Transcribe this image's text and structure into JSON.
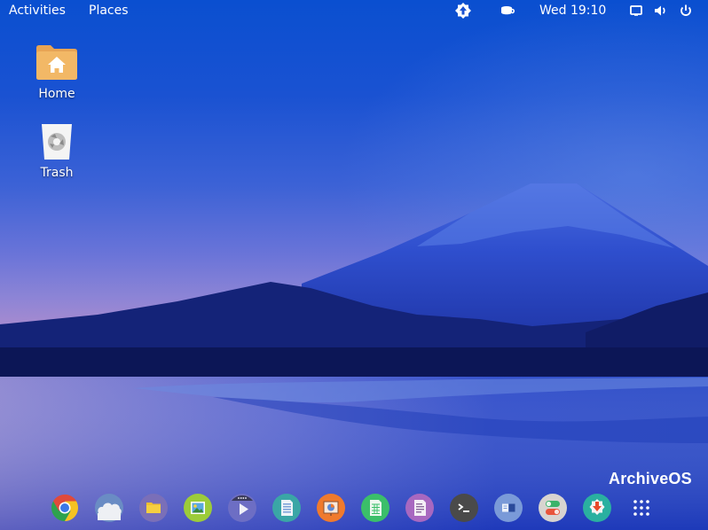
{
  "topbar": {
    "activities_label": "Activities",
    "places_label": "Places",
    "clock": "Wed 19:10",
    "tray_icons": [
      "update-notifier-icon",
      "caffeine-cup-icon",
      "display-icon",
      "volume-icon",
      "power-icon"
    ]
  },
  "desktop": {
    "icons": [
      {
        "label": "Home",
        "icon": "home-folder-icon"
      },
      {
        "label": "Trash",
        "icon": "trash-icon"
      }
    ]
  },
  "watermark": "ArchiveOS",
  "dock": {
    "items": [
      {
        "name": "chrome-browser",
        "icon": "chrome-icon",
        "color": "#e04a3a"
      },
      {
        "name": "cloud",
        "icon": "cloud-icon",
        "color": "#6a8cc4"
      },
      {
        "name": "files",
        "icon": "folder-icon",
        "color": "#7a6fb8"
      },
      {
        "name": "image-viewer",
        "icon": "image-icon",
        "color": "#9ccc3a"
      },
      {
        "name": "video-player",
        "icon": "play-icon",
        "color": "#6d6ec4"
      },
      {
        "name": "text-document",
        "icon": "document-icon",
        "color": "#3aa6a6"
      },
      {
        "name": "presentation",
        "icon": "presentation-icon",
        "color": "#f07a2c"
      },
      {
        "name": "spreadsheet",
        "icon": "spreadsheet-icon",
        "color": "#3bbf6a"
      },
      {
        "name": "notes",
        "icon": "notes-icon",
        "color": "#a868c0"
      },
      {
        "name": "terminal",
        "icon": "terminal-icon",
        "color": "#4a4a4a"
      },
      {
        "name": "window-switcher",
        "icon": "window-icon",
        "color": "#7a9ad8"
      },
      {
        "name": "settings-toggles",
        "icon": "toggles-icon",
        "color": "#d8d4d0"
      },
      {
        "name": "software-updater",
        "icon": "download-badge-icon",
        "color": "#2ab0a0"
      },
      {
        "name": "app-grid",
        "icon": "grid-icon",
        "color": ""
      }
    ]
  }
}
